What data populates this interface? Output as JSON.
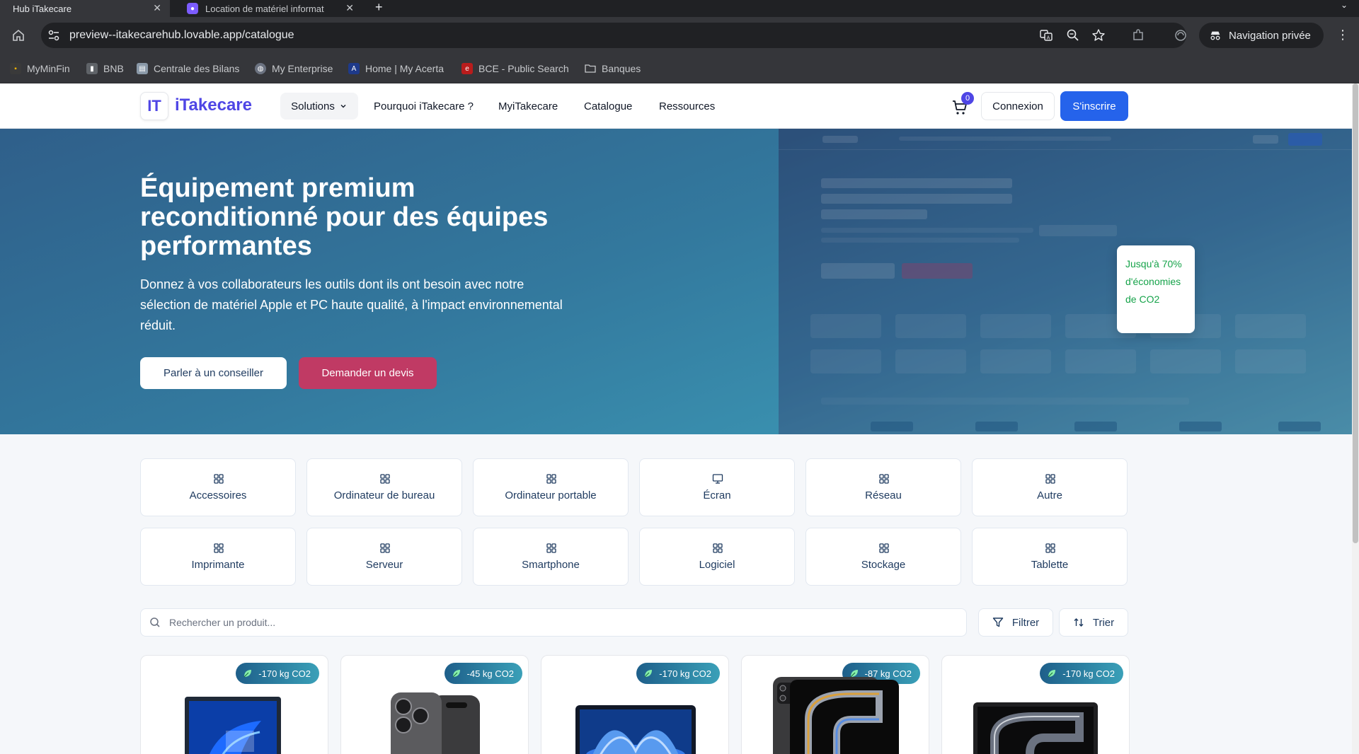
{
  "browser": {
    "tabs": [
      {
        "title": "Hub iTakecare",
        "active": true
      },
      {
        "title": "Location de matériel informat",
        "active": false
      }
    ],
    "url": "preview--itakecarehub.lovable.app/catalogue",
    "private_label": "Navigation privée",
    "bookmarks": [
      {
        "label": "MyMinFin",
        "icon": "myminfin-icon"
      },
      {
        "label": "BNB",
        "icon": "bnb-icon"
      },
      {
        "label": "Centrale des Bilans",
        "icon": "centrale-icon"
      },
      {
        "label": "My Enterprise",
        "icon": "globe-icon"
      },
      {
        "label": "Home | My Acerta",
        "icon": "acerta-icon"
      },
      {
        "label": "BCE - Public Search",
        "icon": "bce-icon"
      },
      {
        "label": "Banques",
        "icon": "folder-icon"
      }
    ]
  },
  "header": {
    "logo_mark": "IT",
    "logo_text": "iTakecare",
    "nav": {
      "solutions": "Solutions",
      "why": "Pourquoi iTakecare ?",
      "my": "MyiTakecare",
      "catalogue": "Catalogue",
      "resources": "Ressources"
    },
    "cart_count": "0",
    "login": "Connexion",
    "signup": "S'inscrire"
  },
  "hero": {
    "title": "Équipement premium reconditionné pour des équipes performantes",
    "subtitle": "Donnez à vos collaborateurs les outils dont ils ont besoin avec notre sélection de matériel Apple et PC haute qualité, à l'impact environnemental réduit.",
    "cta_advisor": "Parler à un conseiller",
    "cta_quote": "Demander un devis",
    "eco_badge": "Jusqu'à 70% d'économies de CO2"
  },
  "categories": [
    {
      "label": "Accessoires",
      "icon": "grid-icon"
    },
    {
      "label": "Ordinateur de bureau",
      "icon": "grid-icon"
    },
    {
      "label": "Ordinateur portable",
      "icon": "grid-icon"
    },
    {
      "label": "Écran",
      "icon": "monitor-icon"
    },
    {
      "label": "Réseau",
      "icon": "grid-icon"
    },
    {
      "label": "Autre",
      "icon": "grid-icon"
    },
    {
      "label": "Imprimante",
      "icon": "grid-icon"
    },
    {
      "label": "Serveur",
      "icon": "grid-icon"
    },
    {
      "label": "Smartphone",
      "icon": "grid-icon"
    },
    {
      "label": "Logiciel",
      "icon": "grid-icon"
    },
    {
      "label": "Stockage",
      "icon": "grid-icon"
    },
    {
      "label": "Tablette",
      "icon": "grid-icon"
    }
  ],
  "search": {
    "placeholder": "Rechercher un produit...",
    "value": ""
  },
  "filter_label": "Filtrer",
  "sort_label": "Trier",
  "products": [
    {
      "co2": "-170 kg CO2",
      "kind": "laptop"
    },
    {
      "co2": "-45 kg CO2",
      "kind": "phone"
    },
    {
      "co2": "-170 kg CO2",
      "kind": "laptop"
    },
    {
      "co2": "-87 kg CO2",
      "kind": "tablet"
    },
    {
      "co2": "-170 kg CO2",
      "kind": "laptop"
    }
  ],
  "colors": {
    "brand": "#4f46e5",
    "primary": "#2563eb",
    "accent": "#c03a64",
    "eco": "#16a34a"
  }
}
